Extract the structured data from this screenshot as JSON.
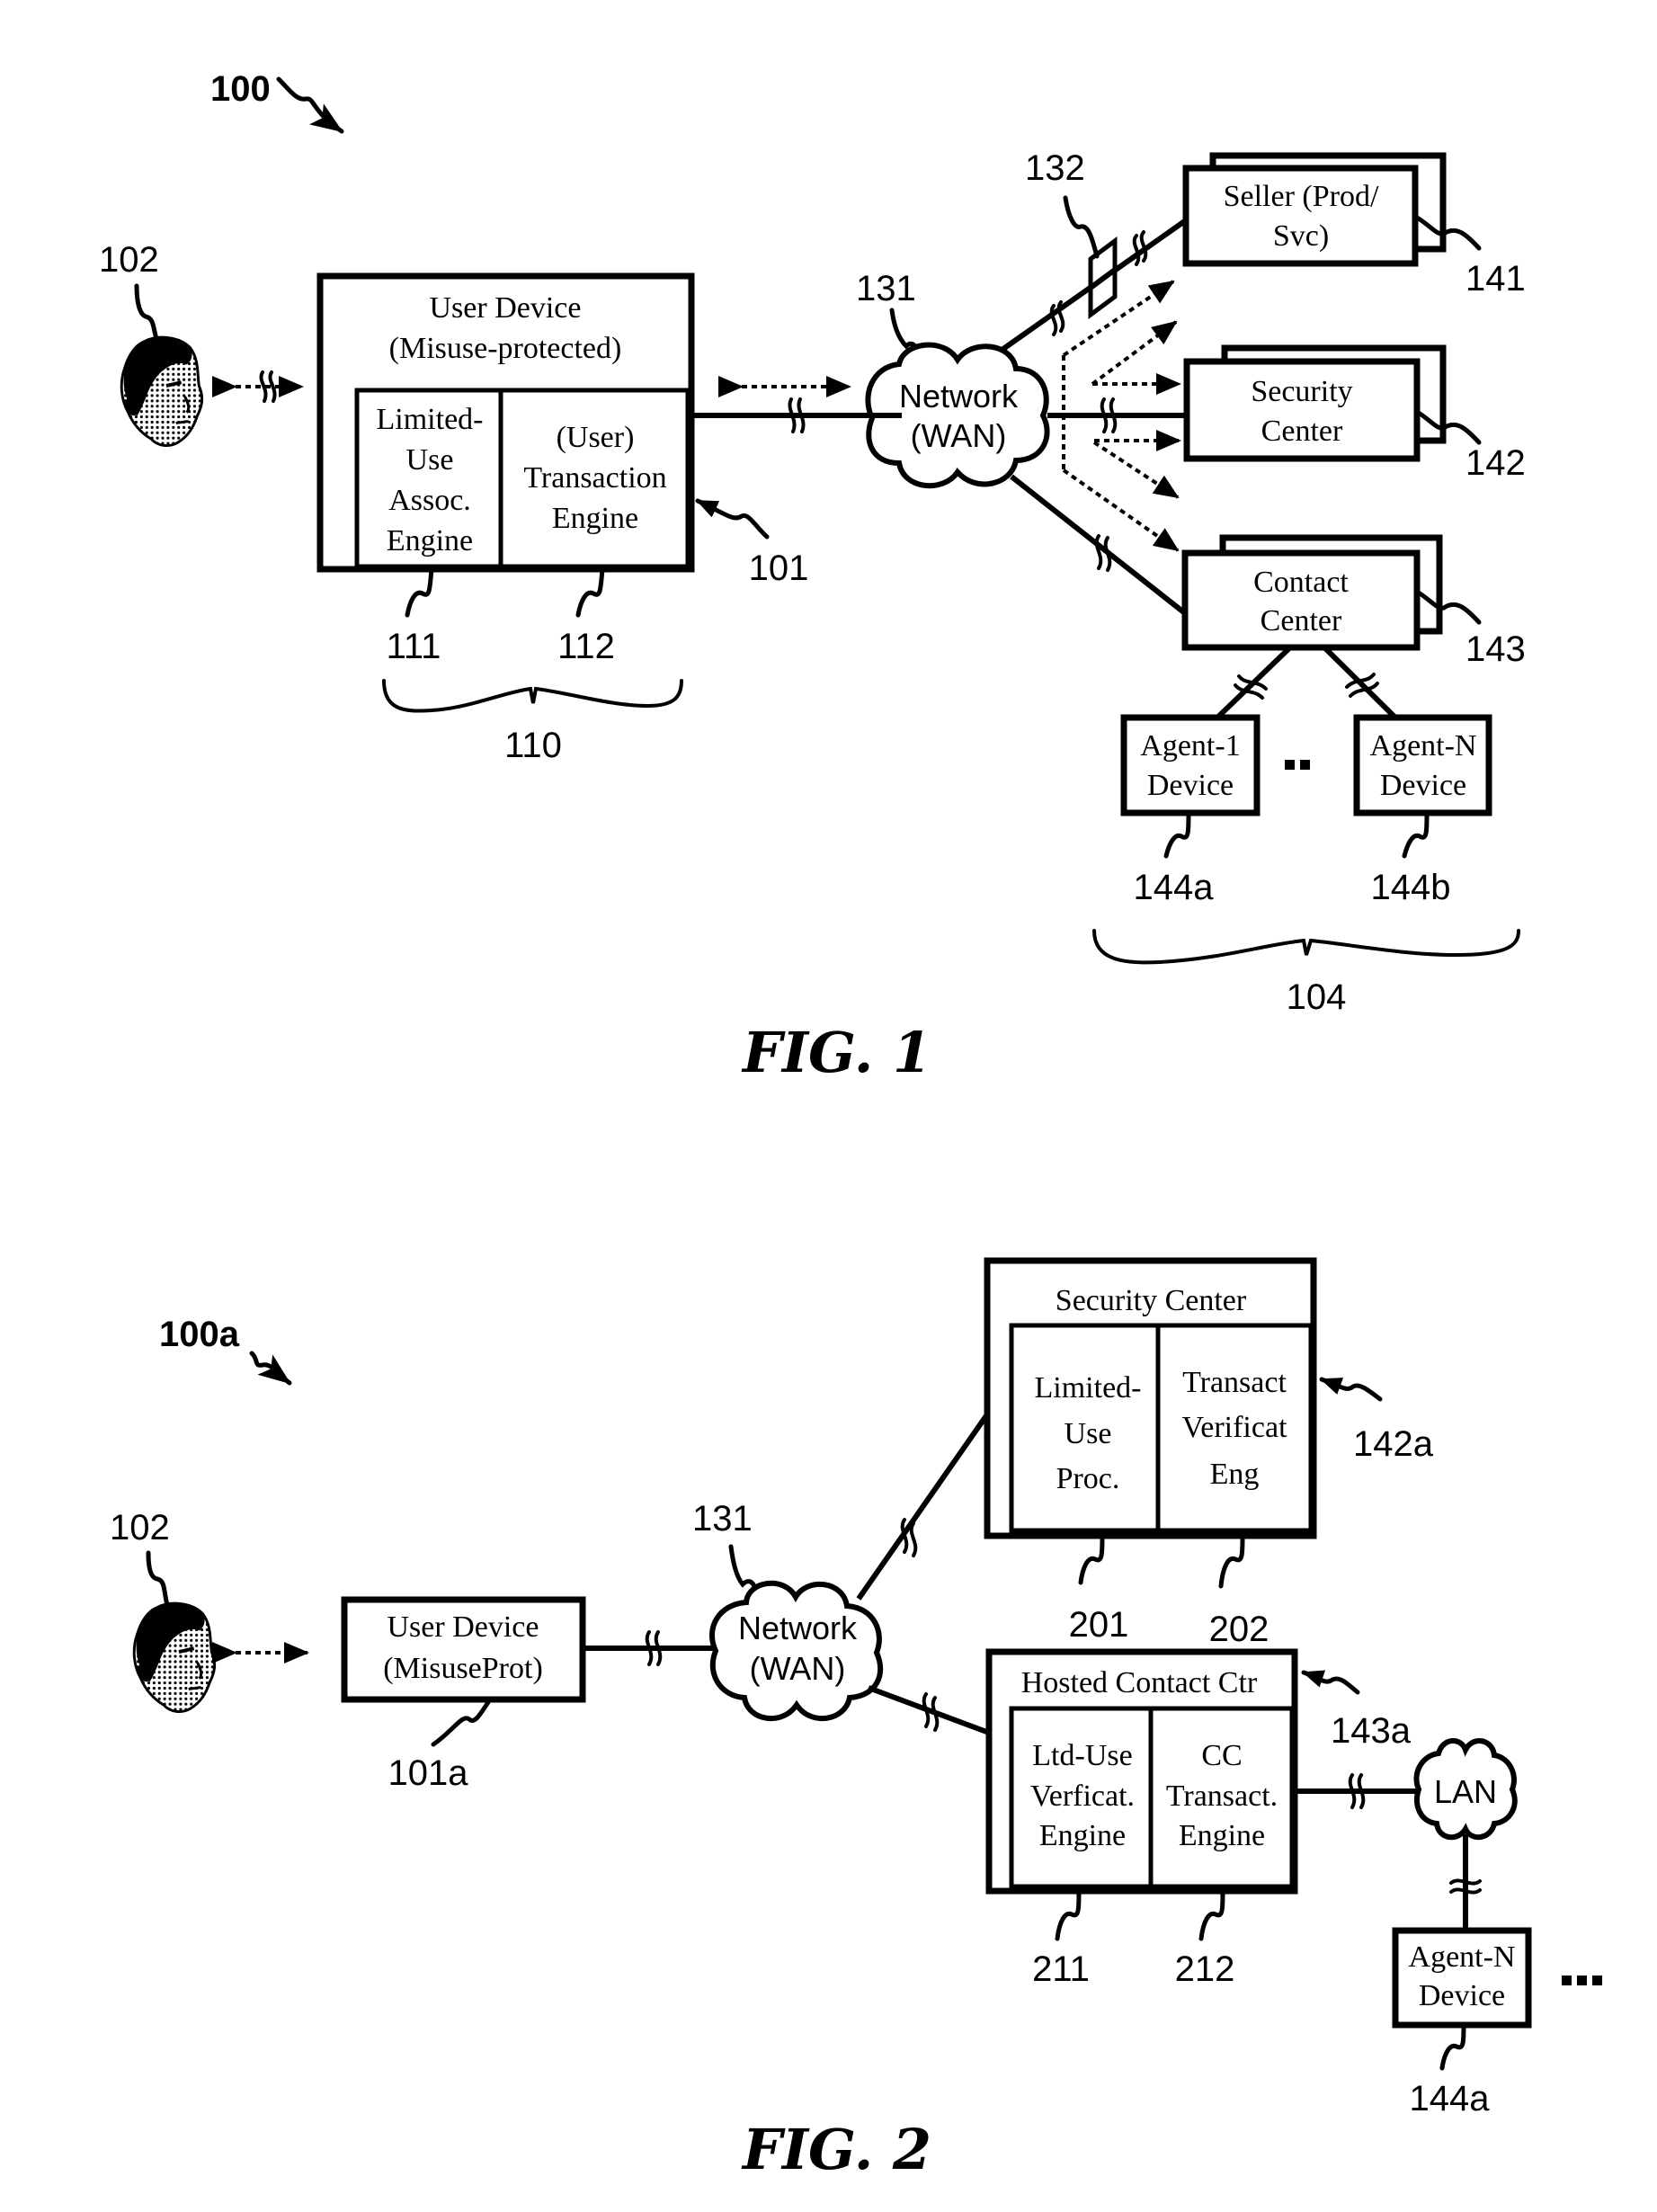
{
  "figure1": {
    "ref_label": "100",
    "caption": "FIG. 1",
    "user": {
      "ref": "102",
      "icon": "user-head-icon"
    },
    "user_device": {
      "ref": "101",
      "title_line1": "User Device",
      "title_line2": "(Misuse-protected)",
      "group_ref": "110",
      "engines": [
        {
          "ref": "111",
          "lines": [
            "Limited-",
            "Use",
            "Assoc.",
            "Engine"
          ]
        },
        {
          "ref": "112",
          "lines": [
            "(User)",
            "Transaction",
            "Engine"
          ]
        }
      ]
    },
    "network": {
      "ref": "131",
      "line1": "Network",
      "line2": "(WAN)"
    },
    "device_132": {
      "ref": "132"
    },
    "seller": {
      "ref": "141",
      "line1": "Seller (Prod/",
      "line2": "Svc)"
    },
    "security_center": {
      "ref": "142",
      "line1": "Security",
      "line2": "Center"
    },
    "contact_center": {
      "ref": "143",
      "line1": "Contact",
      "line2": "Center"
    },
    "agents": {
      "group_ref": "104",
      "ellipsis": "..",
      "items": [
        {
          "ref": "144a",
          "line1": "Agent-1",
          "line2": "Device"
        },
        {
          "ref": "144b",
          "line1": "Agent-N",
          "line2": "Device"
        }
      ]
    }
  },
  "figure2": {
    "ref_label": "100a",
    "caption": "FIG. 2",
    "user": {
      "ref": "102",
      "icon": "user-head-icon"
    },
    "user_device": {
      "ref": "101a",
      "line1": "User Device",
      "line2": "(MisuseProt)"
    },
    "network": {
      "ref": "131",
      "line1": "Network",
      "line2": "(WAN)"
    },
    "security_center": {
      "ref": "142a",
      "title": "Security Center",
      "engines": [
        {
          "ref": "201",
          "lines": [
            "Limited-",
            "Use",
            "Proc."
          ]
        },
        {
          "ref": "202",
          "lines": [
            "Transact",
            "Verificat",
            "Eng"
          ]
        }
      ]
    },
    "hosted_contact_center": {
      "ref": "143a",
      "title": "Hosted Contact Ctr",
      "engines": [
        {
          "ref": "211",
          "lines": [
            "Ltd-Use",
            "Verficat.",
            "Engine"
          ]
        },
        {
          "ref": "212",
          "lines": [
            "CC",
            "Transact.",
            "Engine"
          ]
        }
      ]
    },
    "lan": {
      "label": "LAN"
    },
    "agent": {
      "ref": "144a",
      "line1": "Agent-N",
      "line2": "Device"
    },
    "ellipsis": "..."
  }
}
